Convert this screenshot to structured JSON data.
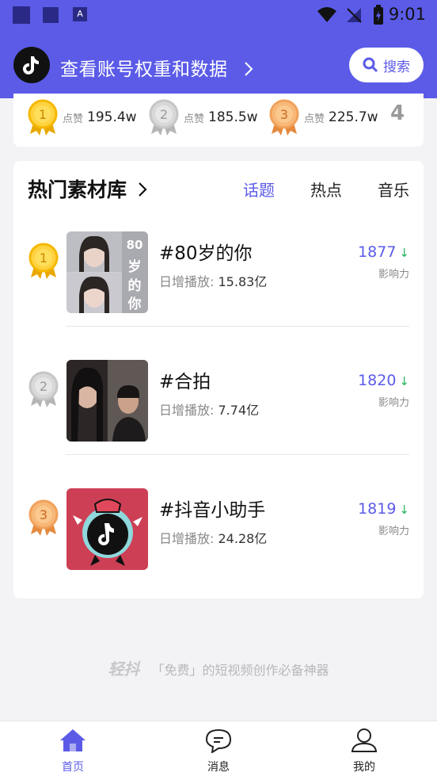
{
  "status_bar": {
    "time": "9:01"
  },
  "header": {
    "title": "查看账号权重和数据",
    "search_label": "搜索"
  },
  "top_ranking": {
    "items": [
      {
        "rank": "1",
        "label": "点赞",
        "value": "195.4w"
      },
      {
        "rank": "2",
        "label": "点赞",
        "value": "185.5w"
      },
      {
        "rank": "3",
        "label": "点赞",
        "value": "225.7w"
      }
    ],
    "next_rank": "4"
  },
  "material": {
    "title": "热门素材库",
    "tabs": [
      "话题",
      "热点",
      "音乐"
    ],
    "active_tab": "话题",
    "thumb_text": "80岁的你",
    "items": [
      {
        "rank": "1",
        "title": "#80岁的你",
        "stat_label": "日增播放:",
        "stat_value": "15.83亿",
        "score": "1877",
        "score_label": "影响力"
      },
      {
        "rank": "2",
        "title": "#合拍",
        "stat_label": "日增播放:",
        "stat_value": "7.74亿",
        "score": "1820",
        "score_label": "影响力"
      },
      {
        "rank": "3",
        "title": "#抖音小助手",
        "stat_label": "日增播放:",
        "stat_value": "24.28亿",
        "score": "1819",
        "score_label": "影响力"
      }
    ]
  },
  "footer": {
    "brand": "轻抖",
    "slogan": "「免费」的短视频创作必备神器"
  },
  "nav": {
    "items": [
      {
        "label": "首页",
        "icon": "home-icon",
        "active": true
      },
      {
        "label": "消息",
        "icon": "message-icon",
        "active": false
      },
      {
        "label": "我的",
        "icon": "user-icon",
        "active": false
      }
    ]
  },
  "colors": {
    "accent": "#5b5be8",
    "gold": "#f5b800",
    "silver": "#c6c6c6",
    "bronze": "#f2a15a",
    "down": "#22b45c"
  }
}
